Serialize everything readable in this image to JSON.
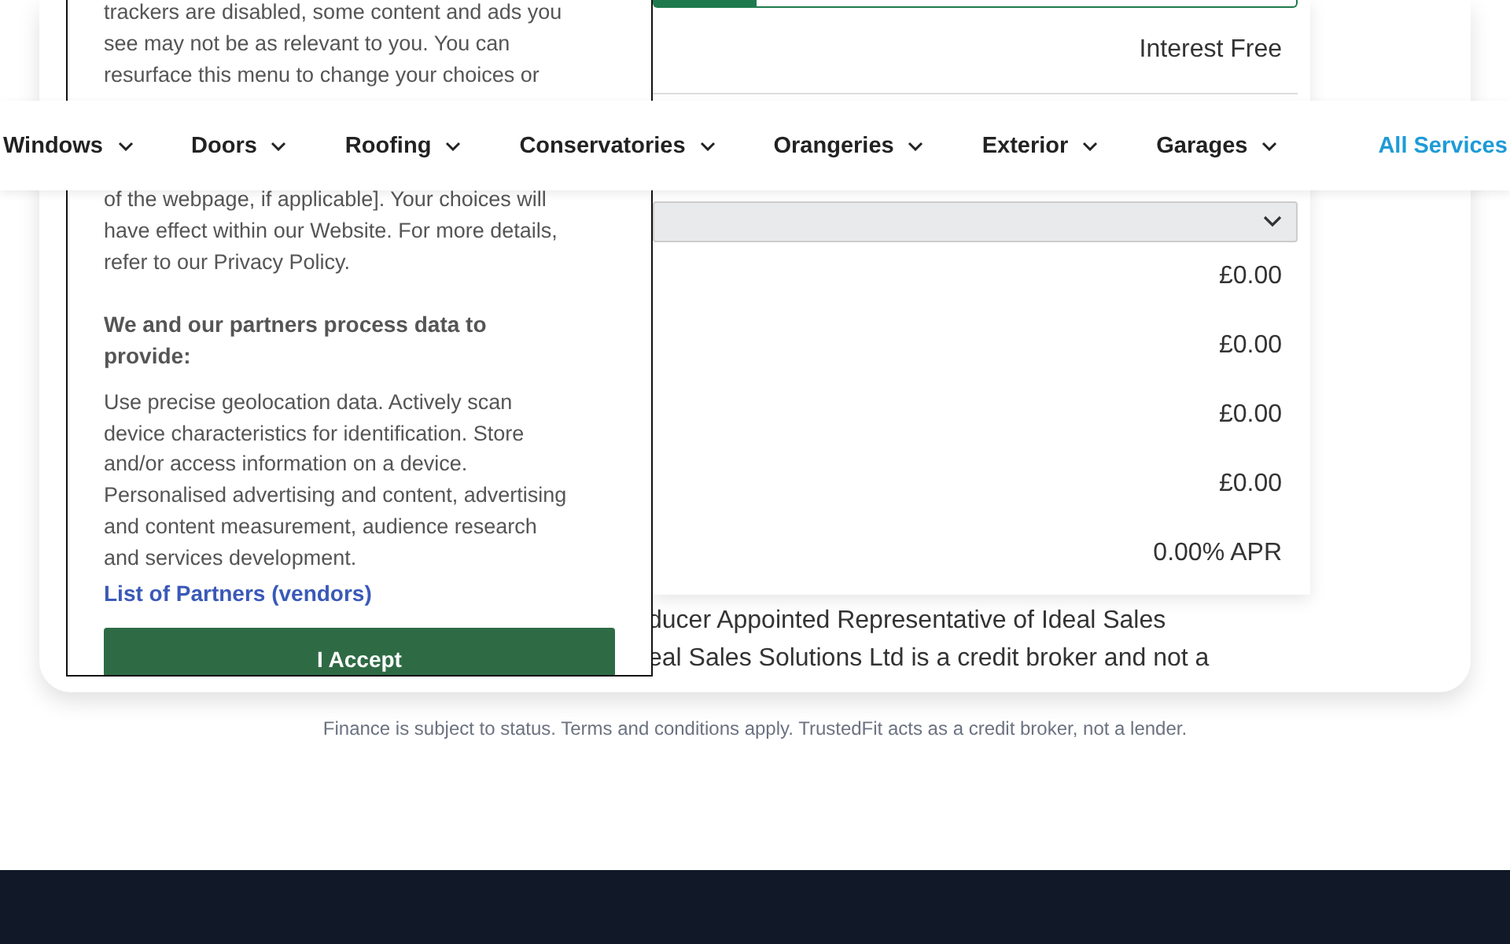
{
  "calculator": {
    "term_bar": {
      "level": 0.16
    },
    "rate_label": "Interest Free",
    "results": [
      {
        "value": "£0.00"
      },
      {
        "value": "£0.00"
      },
      {
        "value": "£0.00"
      },
      {
        "value": "£0.00"
      },
      {
        "value": "0.00% APR"
      }
    ],
    "fine_print": [
      "ducer Appointed Representative of Ideal Sales",
      "eal Sales Solutions Ltd is a credit broker and not a"
    ]
  },
  "footer_note": "Finance is subject to status. Terms and conditions apply. TrustedFit acts as a credit broker, not a lender.",
  "nav": {
    "items": [
      {
        "label": "Windows"
      },
      {
        "label": "Doors"
      },
      {
        "label": "Roofing"
      },
      {
        "label": "Conservatories"
      },
      {
        "label": "Orangeries"
      },
      {
        "label": "Exterior"
      },
      {
        "label": "Garages"
      }
    ],
    "all_link": "All Services"
  },
  "consent_dialog": {
    "text_top": [
      "trackers are disabled, some content and ads you",
      "see may not be as relevant to you. You can",
      "resurface this menu to change your choices or"
    ],
    "text_bottom": [
      "of the webpage, if applicable]. Your choices will",
      "have effect within our Website. For more details,",
      "refer to our Privacy Policy."
    ],
    "heading": "We and our partners process data to provide:",
    "purposes": "Use precise geolocation data. Actively scan device characteristics for identification. Store and/or access information on a device. Personalised advertising and content, advertising and content measurement, audience research and services development.",
    "partners_link": "List of Partners (vendors)",
    "accept_button": "I Accept"
  }
}
